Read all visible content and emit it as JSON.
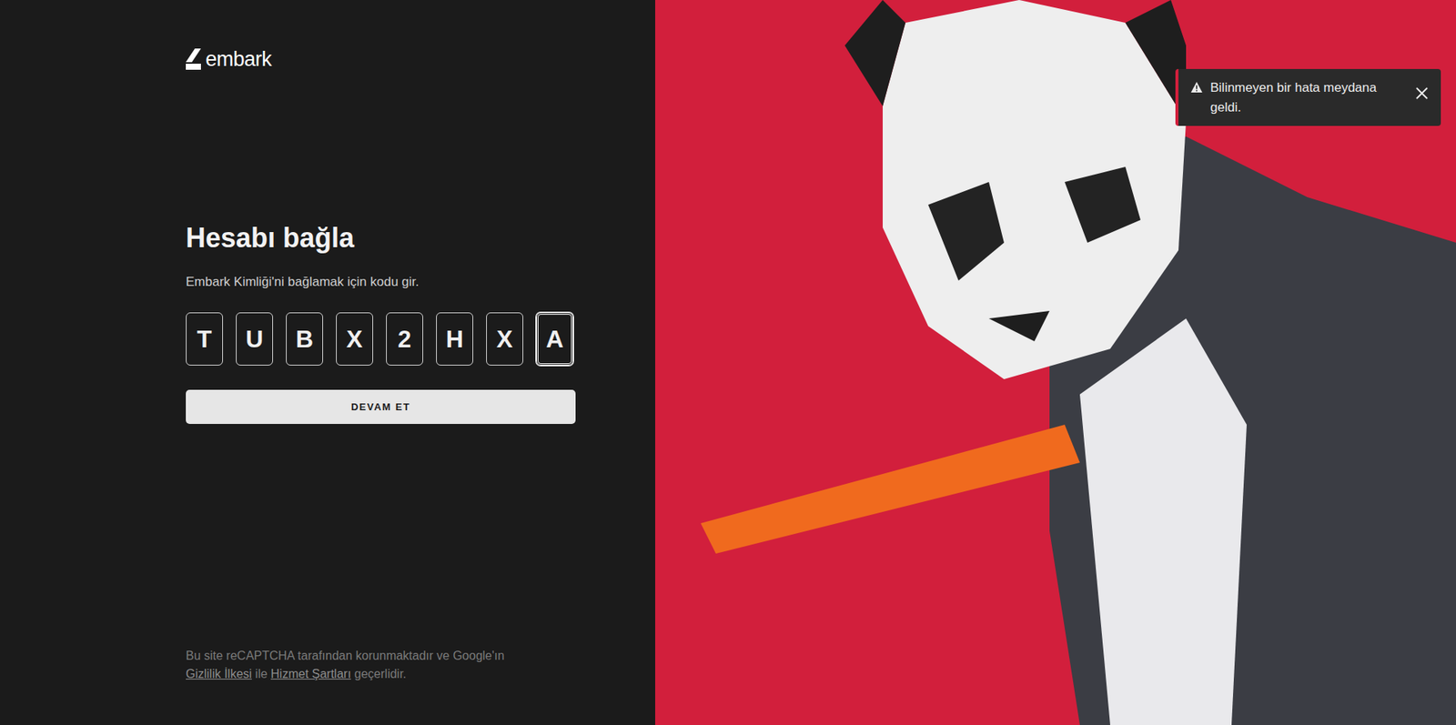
{
  "logo": {
    "text": "embark"
  },
  "heading": "Hesabı bağla",
  "subtitle": "Embark Kimliği'ni bağlamak için kodu gir.",
  "code": [
    {
      "char": "T",
      "focused": false
    },
    {
      "char": "U",
      "focused": false
    },
    {
      "char": "B",
      "focused": false
    },
    {
      "char": "X",
      "focused": false
    },
    {
      "char": "2",
      "focused": false
    },
    {
      "char": "H",
      "focused": false
    },
    {
      "char": "X",
      "focused": false
    },
    {
      "char": "A",
      "focused": true
    }
  ],
  "button": "DEVAM ET",
  "footer": {
    "before": "Bu site reCAPTCHA tarafından korunmaktadır ve Google'ın",
    "privacy": "Gizlilik İlkesi",
    "middle": "ile",
    "terms": "Hizmet Şartları",
    "after": "geçerlidir."
  },
  "toast": {
    "message": "Bilinmeyen bir hata meydana geldi."
  }
}
